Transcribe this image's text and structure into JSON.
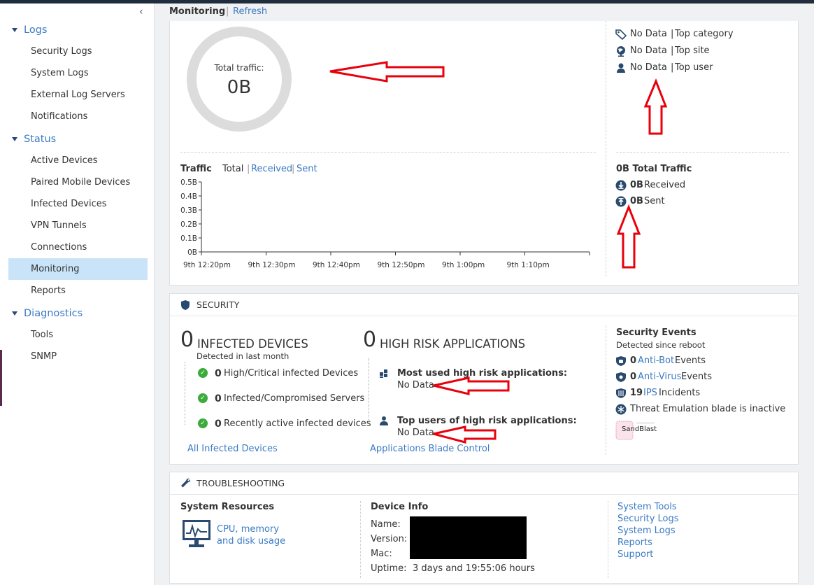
{
  "sidebar": {
    "collapse_glyph": "‹",
    "sections": [
      {
        "label": "Logs",
        "items": [
          "Security Logs",
          "System Logs",
          "External Log Servers",
          "Notifications"
        ]
      },
      {
        "label": "Status",
        "items": [
          "Active Devices",
          "Paired Mobile Devices",
          "Infected Devices",
          "VPN Tunnels",
          "Connections",
          "Monitoring",
          "Reports"
        ]
      },
      {
        "label": "Diagnostics",
        "items": [
          "Tools",
          "SNMP"
        ]
      }
    ],
    "active_item": "Monitoring"
  },
  "header": {
    "title": "Monitoring",
    "separator": "|",
    "refresh": "Refresh"
  },
  "traffic_summary": {
    "ring_label": "Total traffic:",
    "ring_value": "0B",
    "top_rows": [
      {
        "icon": "tag-icon",
        "value": "No Data",
        "label": "Top category"
      },
      {
        "icon": "globe-icon",
        "value": "No Data",
        "label": "Top site"
      },
      {
        "icon": "user-icon",
        "value": "No Data",
        "label": "Top user"
      }
    ],
    "separator": "|"
  },
  "traffic_chart": {
    "title": "Traffic",
    "tabs": [
      "Total",
      "Received",
      "Sent"
    ],
    "active_tab": "Total",
    "y_ticks": [
      "0.5B",
      "0.4B",
      "0.3B",
      "0.2B",
      "0.1B",
      "0B"
    ],
    "x_ticks": [
      "9th 12:20pm",
      "9th 12:30pm",
      "9th 12:40pm",
      "9th 12:50pm",
      "9th 1:00pm",
      "9th 1:10pm"
    ]
  },
  "chart_data": {
    "type": "line",
    "title": "Traffic",
    "x": [
      "9th 12:20pm",
      "9th 12:30pm",
      "9th 12:40pm",
      "9th 12:50pm",
      "9th 1:00pm",
      "9th 1:10pm"
    ],
    "series": [
      {
        "values": [
          0,
          0,
          0,
          0,
          0,
          0
        ]
      }
    ],
    "ylim": [
      0,
      0.5
    ],
    "y_unit": "B",
    "grid": false
  },
  "traffic_totals": {
    "title": "0B Total Traffic",
    "received_value": "0B",
    "received_label": "Received",
    "sent_value": "0B",
    "sent_label": "Sent"
  },
  "security": {
    "section_title": "SECURITY",
    "infected": {
      "count": "0",
      "title": "INFECTED DEVICES",
      "subtitle": "Detected in last month",
      "rows": [
        {
          "count": "0",
          "label": "High/Critical infected Devices"
        },
        {
          "count": "0",
          "label": "Infected/Compromised Servers"
        },
        {
          "count": "0",
          "label": "Recently active infected devices"
        }
      ],
      "link": "All Infected Devices"
    },
    "high_risk": {
      "count": "0",
      "title": "HIGH RISK APPLICATIONS",
      "most_used_title": "Most used high risk applications:",
      "most_used_value": "No Data",
      "top_users_title": "Top users of high risk applications:",
      "top_users_value": "No Data",
      "link": "Applications Blade Control"
    },
    "events": {
      "title": "Security Events",
      "subtitle": "Detected since reboot",
      "antibot_count": "0",
      "antibot_link": "Anti-Bot",
      "antibot_suffix": "Events",
      "antivirus_count": "0",
      "antivirus_link": "Anti-Virus",
      "antivirus_suffix": "Events",
      "ips_count": "19",
      "ips_link": "IPS",
      "ips_suffix": "Incidents",
      "threat_emulation": "Threat Emulation blade is inactive",
      "sandblast_logo": "SandBlast"
    }
  },
  "troubleshooting": {
    "section_title": "TROUBLESHOOTING",
    "system_resources_title": "System Resources",
    "system_resources_link_line1": "CPU, memory",
    "system_resources_link_line2": "and disk usage",
    "device_info_title": "Device Info",
    "name_label": "Name:",
    "version_label": "Version:",
    "mac_label": "Mac:",
    "uptime_label": "Uptime:",
    "uptime_value": "3 days and 19:55:06 hours",
    "links": [
      "System Tools",
      "Security Logs",
      "System Logs",
      "Reports",
      "Support"
    ]
  },
  "colors": {
    "accent": "#3b7bc4",
    "active_bg": "#c9e4f8",
    "annotation_red": "#e8000b",
    "icon_navy": "#2a4a6f",
    "check_green": "#3cab3c"
  }
}
